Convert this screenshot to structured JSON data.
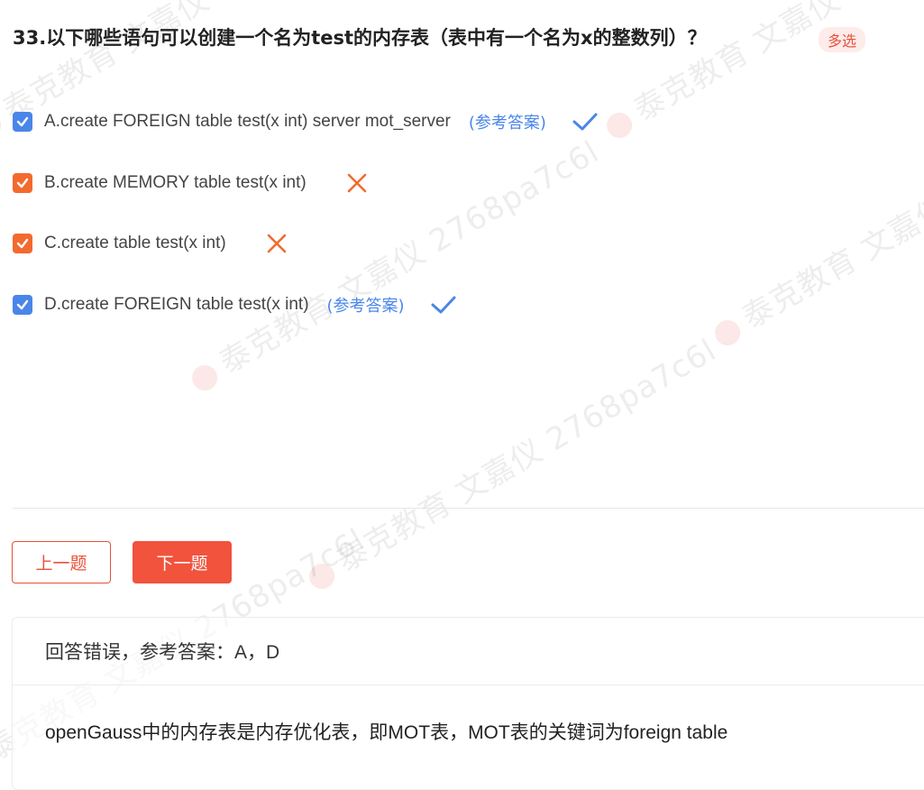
{
  "question": {
    "title": "33.以下哪些语句可以创建一个名为test的内存表（表中有一个名为x的整数列）？",
    "type_badge": "多选"
  },
  "options": [
    {
      "text": "A.create FOREIGN table test(x int) server mot_server",
      "ref_label": "(参考答案)",
      "result": "correct"
    },
    {
      "text": "B.create MEMORY table test(x int)",
      "ref_label": "",
      "result": "wrong"
    },
    {
      "text": "C.create table test(x int)",
      "ref_label": "",
      "result": "wrong"
    },
    {
      "text": "D.create FOREIGN table test(x int)",
      "ref_label": "(参考答案)",
      "result": "correct"
    }
  ],
  "nav": {
    "prev_label": "上一题",
    "next_label": "下一题"
  },
  "answer": {
    "status": "回答错误，参考答案：A，D",
    "explanation": "openGauss中的内存表是内存优化表，即MOT表，MOT表的关键词为foreign table"
  },
  "watermark": {
    "company": "泰克教育",
    "user": "文嘉仪",
    "code": "2768pa7c6l"
  },
  "colors": {
    "accent_red": "#f1533d",
    "correct_blue": "#4a86e8",
    "wrong_orange": "#f26a2e"
  }
}
